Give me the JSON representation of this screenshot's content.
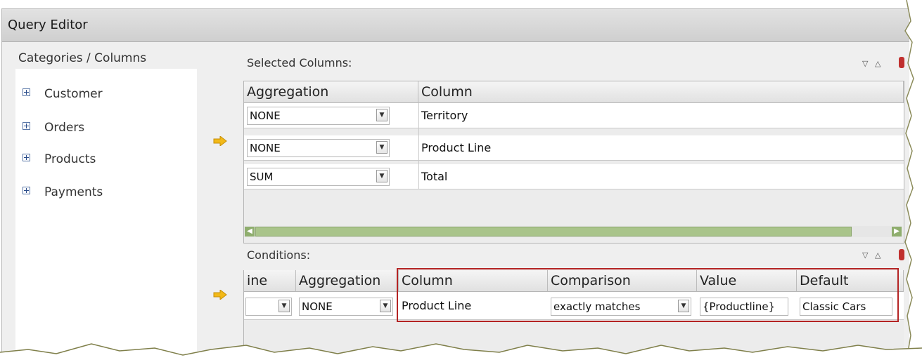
{
  "window": {
    "title": "Query Editor"
  },
  "left_panel": {
    "title": "Categories / Columns",
    "items": [
      {
        "label": "Customer"
      },
      {
        "label": "Orders"
      },
      {
        "label": "Products"
      },
      {
        "label": "Payments"
      }
    ]
  },
  "selected_columns": {
    "title": "Selected Columns:",
    "headers": {
      "aggregation": "Aggregation",
      "column": "Column"
    },
    "rows": [
      {
        "aggregation": "NONE",
        "column": "Territory"
      },
      {
        "aggregation": "NONE",
        "column": "Product Line"
      },
      {
        "aggregation": "SUM",
        "column": "Total"
      }
    ]
  },
  "conditions": {
    "title": "Conditions:",
    "headers": {
      "line": "ine",
      "aggregation": "Aggregation",
      "column": "Column",
      "comparison": "Comparison",
      "value": "Value",
      "default": "Default"
    },
    "row": {
      "line": "",
      "aggregation": "NONE",
      "column": "Product Line",
      "comparison": "exactly matches",
      "value": "{Productline}",
      "default": "Classic Cars"
    }
  },
  "colors": {
    "highlight": "#b42424",
    "arrow": "#f2b918",
    "scroll": "#a9c48a"
  }
}
